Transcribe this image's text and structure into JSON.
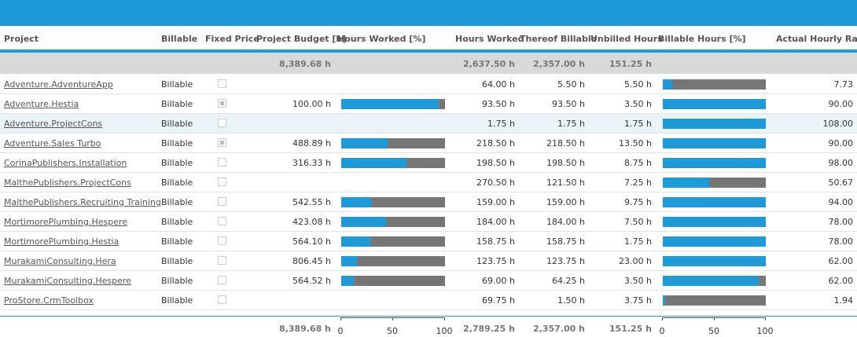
{
  "columns": {
    "project": "Project",
    "billable": "Billable",
    "fixed_price": "Fixed Price",
    "project_budget": "Project Budget [h]",
    "hours_worked_pct": "Hours Worked [%]",
    "hours_worked": "Hours Worked",
    "thereof_billable": "Thereof Billable",
    "unbilled_hours": "Unbilled Hours",
    "billable_hours_pct": "Billable Hours [%]",
    "actual_hourly_rate": "Actual Hourly Rate"
  },
  "summary": {
    "project_budget": "8,389.68 h",
    "hours_worked": "2,637.50 h",
    "thereof_billable": "2,357.00 h",
    "unbilled_hours": "151.25 h"
  },
  "rows": [
    {
      "project": "Adventure.AdventureApp",
      "billable": "Billable",
      "fixed": false,
      "budget": "",
      "hw_pct": null,
      "hours": "64.00 h",
      "thereof": "5.50 h",
      "unbilled": "5.50 h",
      "bh_pct": 9,
      "rate": "7.73"
    },
    {
      "project": "Adventure.Hestia",
      "billable": "Billable",
      "fixed": true,
      "budget": "100.00 h",
      "hw_pct": 94,
      "hours": "93.50 h",
      "thereof": "93.50 h",
      "unbilled": "3.50 h",
      "bh_pct": 100,
      "rate": "90.00"
    },
    {
      "project": "Adventure.ProjectCons",
      "billable": "Billable",
      "fixed": false,
      "budget": "",
      "hw_pct": null,
      "hours": "1.75 h",
      "thereof": "1.75 h",
      "unbilled": "1.75 h",
      "bh_pct": 100,
      "rate": "108.00"
    },
    {
      "project": "Adventure.Sales Turbo",
      "billable": "Billable",
      "fixed": true,
      "budget": "488.89 h",
      "hw_pct": 45,
      "hours": "218.50 h",
      "thereof": "218.50 h",
      "unbilled": "13.50 h",
      "bh_pct": 100,
      "rate": "90.00"
    },
    {
      "project": "CorinaPublishers.Installation",
      "billable": "Billable",
      "fixed": false,
      "budget": "316.33 h",
      "hw_pct": 63,
      "hours": "198.50 h",
      "thereof": "198.50 h",
      "unbilled": "8.75 h",
      "bh_pct": 100,
      "rate": "98.00"
    },
    {
      "project": "MalthePublishers.ProjectCons",
      "billable": "Billable",
      "fixed": false,
      "budget": "",
      "hw_pct": null,
      "hours": "270.50 h",
      "thereof": "121.50 h",
      "unbilled": "7.25 h",
      "bh_pct": 45,
      "rate": "50.67"
    },
    {
      "project": "MalthePublishers.Recruiting Training",
      "billable": "Billable",
      "fixed": false,
      "budget": "542.55 h",
      "hw_pct": 29,
      "hours": "159.00 h",
      "thereof": "159.00 h",
      "unbilled": "9.75 h",
      "bh_pct": 100,
      "rate": "94.00"
    },
    {
      "project": "MortimorePlumbing.Hespere",
      "billable": "Billable",
      "fixed": false,
      "budget": "423.08 h",
      "hw_pct": 43,
      "hours": "184.00 h",
      "thereof": "184.00 h",
      "unbilled": "7.50 h",
      "bh_pct": 100,
      "rate": "78.00"
    },
    {
      "project": "MortimorePlumbing.Hestia",
      "billable": "Billable",
      "fixed": false,
      "budget": "564.10 h",
      "hw_pct": 28,
      "hours": "158.75 h",
      "thereof": "158.75 h",
      "unbilled": "1.75 h",
      "bh_pct": 100,
      "rate": "78.00"
    },
    {
      "project": "MurakamiConsulting.Hera",
      "billable": "Billable",
      "fixed": false,
      "budget": "806.45 h",
      "hw_pct": 15,
      "hours": "123.75 h",
      "thereof": "123.75 h",
      "unbilled": "23.00 h",
      "bh_pct": 100,
      "rate": "62.00"
    },
    {
      "project": "MurakamiConsulting.Hespere",
      "billable": "Billable",
      "fixed": false,
      "budget": "564.52 h",
      "hw_pct": 12,
      "hours": "69.00 h",
      "thereof": "64.25 h",
      "unbilled": "3.50 h",
      "bh_pct": 93,
      "rate": "62.00"
    },
    {
      "project": "ProStore.CrmToolbox",
      "billable": "Billable",
      "fixed": false,
      "budget": "",
      "hw_pct": null,
      "hours": "69.75 h",
      "thereof": "1.50 h",
      "unbilled": "3.75 h",
      "bh_pct": 2,
      "rate": "1.94"
    }
  ],
  "footer": {
    "project_budget": "8,389.68 h",
    "hours_worked": "2,789.25 h",
    "thereof_billable": "2,357.00 h",
    "unbilled_hours": "151.25 h",
    "axis_ticks": [
      "0",
      "50",
      "100"
    ]
  },
  "colors": {
    "accent": "#1e9ad8",
    "bar_remainder": "#767676",
    "summary_bg": "#d9d9d9",
    "selected_row": "#eaf3f8"
  }
}
